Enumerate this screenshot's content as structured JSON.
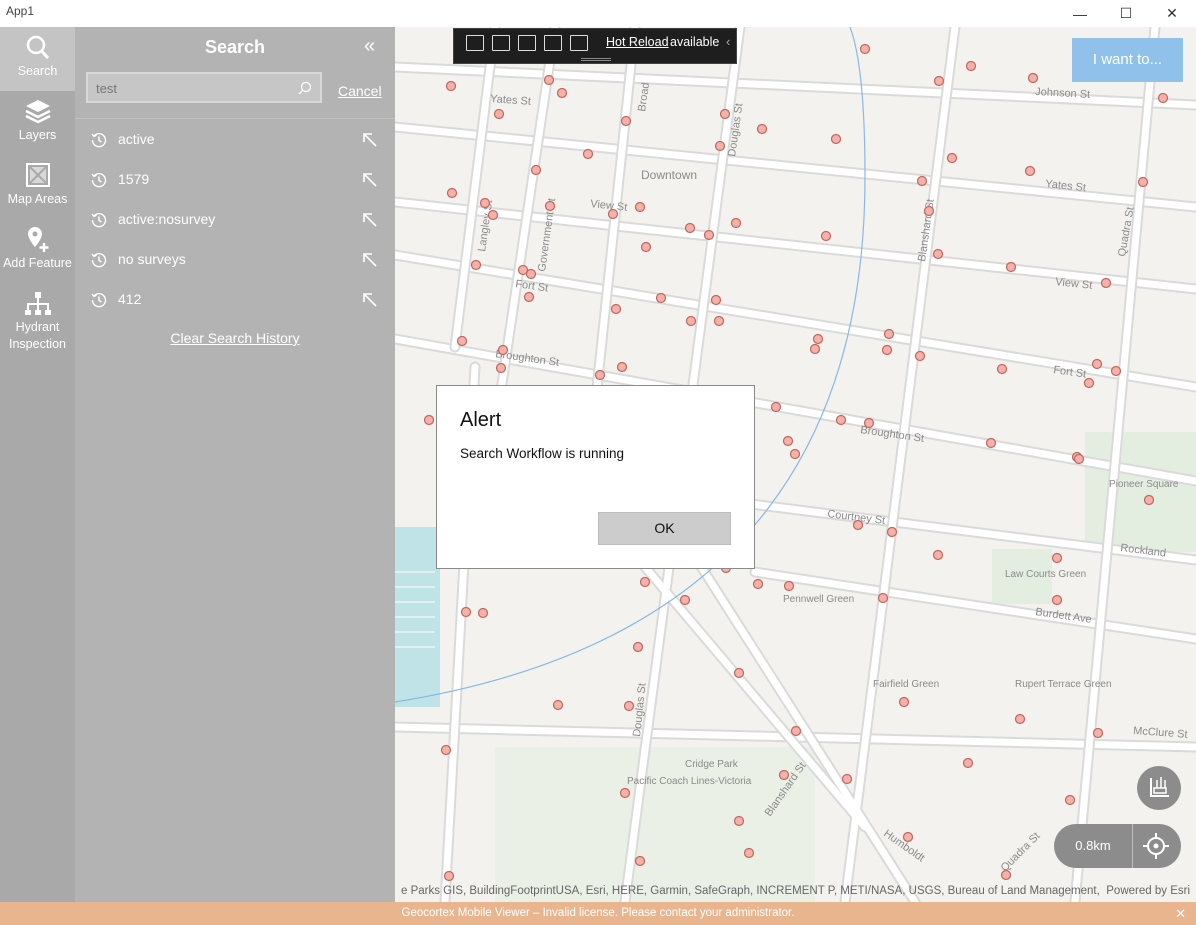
{
  "window": {
    "title": "App1",
    "min_glyph": "—",
    "max_glyph": "☐",
    "close_glyph": "✕"
  },
  "rail": {
    "items": [
      {
        "label": "Search",
        "icon": "search-icon"
      },
      {
        "label": "Layers",
        "icon": "layers-icon"
      },
      {
        "label": "Map Areas",
        "icon": "map-areas-icon"
      },
      {
        "label": "Add Feature",
        "icon": "add-feature-icon"
      },
      {
        "label": "Hydrant",
        "label2": "Inspection",
        "icon": "hydrant-inspection-icon"
      }
    ]
  },
  "search_panel": {
    "title": "Search",
    "collapse_glyph": "«",
    "query": "test",
    "cancel_label": "Cancel",
    "history": [
      "active",
      "1579",
      "active:nosurvey",
      "no surveys",
      "412"
    ],
    "clear_label": "Clear Search History"
  },
  "hot_reload": {
    "link": "Hot Reload",
    "status": "available",
    "chevron": "‹"
  },
  "map": {
    "i_want_label": "I want to...",
    "scale_label": "0.8km",
    "attribution": "e Parks GIS, BuildingFootprintUSA, Esri, HERE, Garmin, SafeGraph, INCREMENT P, METI/NASA, USGS, Bureau of Land Management,...",
    "powered_by": "Powered by Esri",
    "labels": {
      "downtown": "Downtown",
      "johnson": "Johnson St",
      "yates_left": "Yates St",
      "yates_right": "Yates St",
      "view_left": "View St",
      "view_right": "View St",
      "fort_left": "Fort St",
      "fort_right": "Fort St",
      "broughton_left": "Broughton St",
      "broughton_right": "Broughton St",
      "courtney": "Courtney St",
      "burdett": "Burdett Ave",
      "mcclure": "McClure St",
      "rockland": "Rockland",
      "humboldt": "Humboldt",
      "quadra_top": "Quadra St",
      "quadra_bottom": "Quadra St",
      "blanshard_top": "Blanshard St",
      "blanshard_bottom": "Blanshard St",
      "douglas_top": "Douglas St",
      "douglas_bottom": "Douglas St",
      "government": "Government St",
      "langley": "Langley St",
      "broad": "Broad",
      "pioneer": "Pioneer Square",
      "law_courts": "Law Courts Green",
      "pennwell": "Pennwell Green",
      "fairfield": "Fairfield Green",
      "rupert": "Rupert Terrace Green",
      "cridge": "Cridge Park",
      "pacific_coach": "Pacific Coach Lines-Victoria"
    },
    "colors": {
      "background": "#f3f2ee",
      "road": "#d9d9d9",
      "marker_fill": "#f4b1a9",
      "marker_stroke": "#c2655c",
      "park": "#e3eee0",
      "water": "#bfe3e6",
      "accent": "#8fc1ea"
    }
  },
  "alert": {
    "title": "Alert",
    "message": "Search Workflow is running",
    "ok_label": "OK"
  },
  "license_bar": {
    "message": "Geocortex Mobile Viewer – Invalid license. Please contact your administrator.",
    "close_glyph": "✕"
  }
}
